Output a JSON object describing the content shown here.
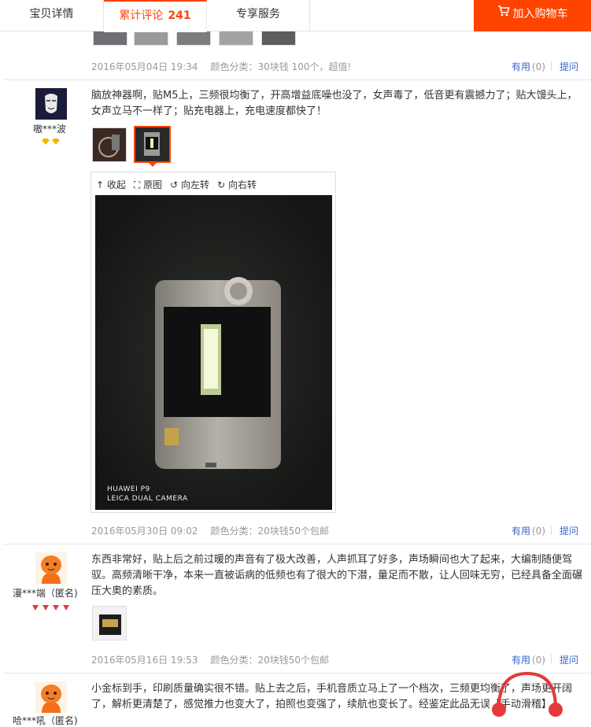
{
  "tabs": {
    "details": "宝贝详情",
    "reviews": "累计评论",
    "reviews_count": "241",
    "services": "专享服务"
  },
  "cart": {
    "label": "加入购物车",
    "icon": "cart-icon"
  },
  "review_top": {
    "date": "2016年05月04日 19:34",
    "spec": "颜色分类：30块钱 100个，超值!"
  },
  "review1": {
    "user": "嗷***波",
    "text": "脑放神器啊，贴M5上，三频很均衡了，开高增益底噪也没了，女声毒了，低音更有震撼力了；贴大馒头上，女声立马不一样了；贴充电器上，充电速度都快了！",
    "viewer": {
      "collapse": "收起",
      "original": "原图",
      "rotate_left": "向左转",
      "rotate_right": "向右转"
    },
    "photo_watermark_1": "HUAWEI P9",
    "photo_watermark_2": "LEICA DUAL CAMERA",
    "date": "2016年05月30日 09:02",
    "spec": "颜色分类：20块钱50个包邮"
  },
  "review2": {
    "user": "漫***端（匿名)",
    "text": "东西非常好，贴上后之前过暖的声音有了极大改善，人声抓耳了好多，声场瞬间也大了起来，大编制随便驾驭。高频清晰干净，本来一直被诟病的低频也有了很大的下潜，量足而不散，让人回味无穷，已经具备全面碾压大奥的素质。",
    "date": "2016年05月16日 19:53",
    "spec": "颜色分类：20块钱50个包邮"
  },
  "review3": {
    "user": "哈***吼（匿名)",
    "text": "小金标到手，印刷质量确实很不错。贴上去之后，手机音质立马上了一个档次，三频更均衡了，声场更开阔了，解析更清楚了，感觉推力也变大了，拍照也变强了，续航也变长了。经鉴定此品无误【手动滑稽】"
  },
  "actions": {
    "useful": "有用",
    "useful_count": "(0)",
    "ask": "提问"
  }
}
